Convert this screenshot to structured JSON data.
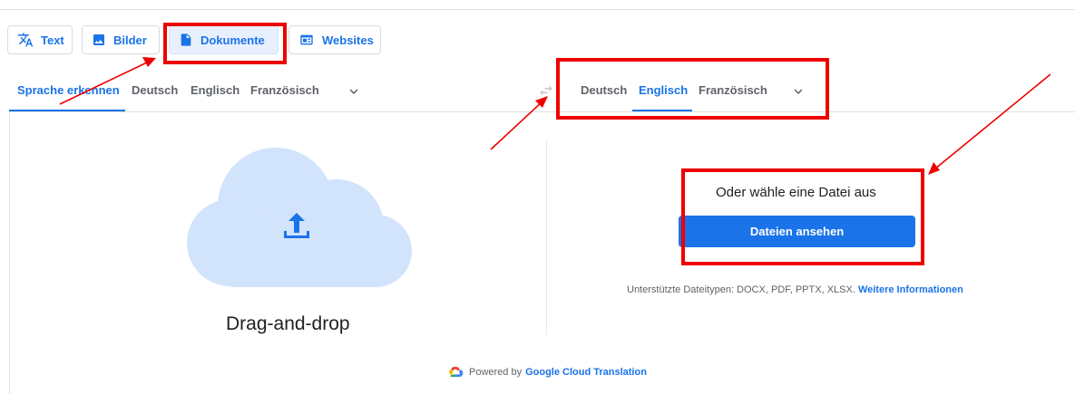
{
  "modes": {
    "text": "Text",
    "images": "Bilder",
    "documents": "Dokumente",
    "websites": "Websites"
  },
  "source_langs": {
    "detect": "Sprache erkennen",
    "german": "Deutsch",
    "english": "Englisch",
    "french": "Französisch"
  },
  "target_langs": {
    "german": "Deutsch",
    "english": "Englisch",
    "french": "Französisch"
  },
  "upload": {
    "drag_drop": "Drag-and-drop",
    "choose_file": "Oder wähle eine Datei aus",
    "browse_button": "Dateien ansehen",
    "supported_types": "Unterstützte Dateitypen: DOCX, PDF, PPTX, XLSX.",
    "more_info": "Weitere Informationen"
  },
  "footer": {
    "powered_by": "Powered by",
    "provider": "Google Cloud Translation"
  },
  "colors": {
    "accent": "#1a73e8",
    "active_bg": "#e8f0fe",
    "cloud": "#d2e3fc",
    "annotation": "#ee0000"
  }
}
